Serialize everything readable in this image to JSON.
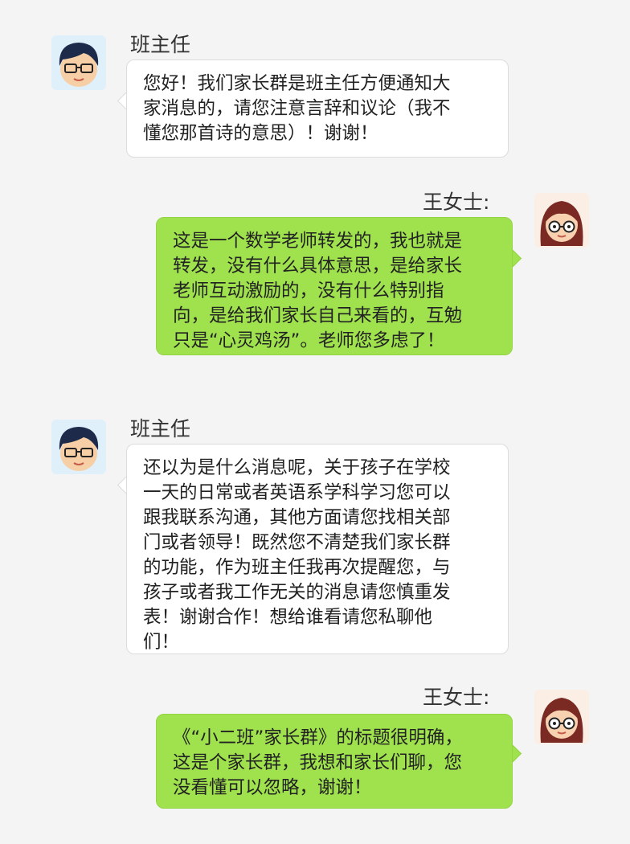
{
  "colors": {
    "background": "#f4f4f4",
    "left_bubble": "#ffffff",
    "right_bubble": "#9fe24e"
  },
  "messages": [
    {
      "sender": "班主任",
      "side": "left",
      "avatar": "teacher-avatar-icon",
      "lines": [
        "您好！我们家长群是班主任方便通知大",
        "家消息的，请您注意言辞和议论（我不",
        "懂您那首诗的意思）！谢谢！"
      ]
    },
    {
      "sender": "王女士:",
      "side": "right",
      "avatar": "parent-avatar-icon",
      "lines": [
        "这是一个数学老师转发的，我也就是",
        "转发，没有什么具体意思，是给家长",
        "老师互动激励的，没有什么特别指",
        "向，是给我们家长自己来看的，互勉",
        "只是“心灵鸡汤”。老师您多虑了！"
      ]
    },
    {
      "sender": "班主任",
      "side": "left",
      "avatar": "teacher-avatar-icon",
      "lines": [
        "还以为是什么消息呢，关于孩子在学校",
        "一天的日常或者英语系学科学习您可以",
        "跟我联系沟通，其他方面请您找相关部",
        "门或者领导！既然您不清楚我们家长群",
        "的功能，作为班主任我再次提醒您，与",
        "孩子或者我工作无关的消息请您慎重发",
        "表！谢谢合作！想给谁看请您私聊他",
        "们！"
      ]
    },
    {
      "sender": "王女士:",
      "side": "right",
      "avatar": "parent-avatar-icon",
      "lines": [
        "《“小二班”家长群》的标题很明确，",
        "这是个家长群，我想和家长们聊，您",
        "没看懂可以忽略，谢谢！"
      ]
    }
  ]
}
